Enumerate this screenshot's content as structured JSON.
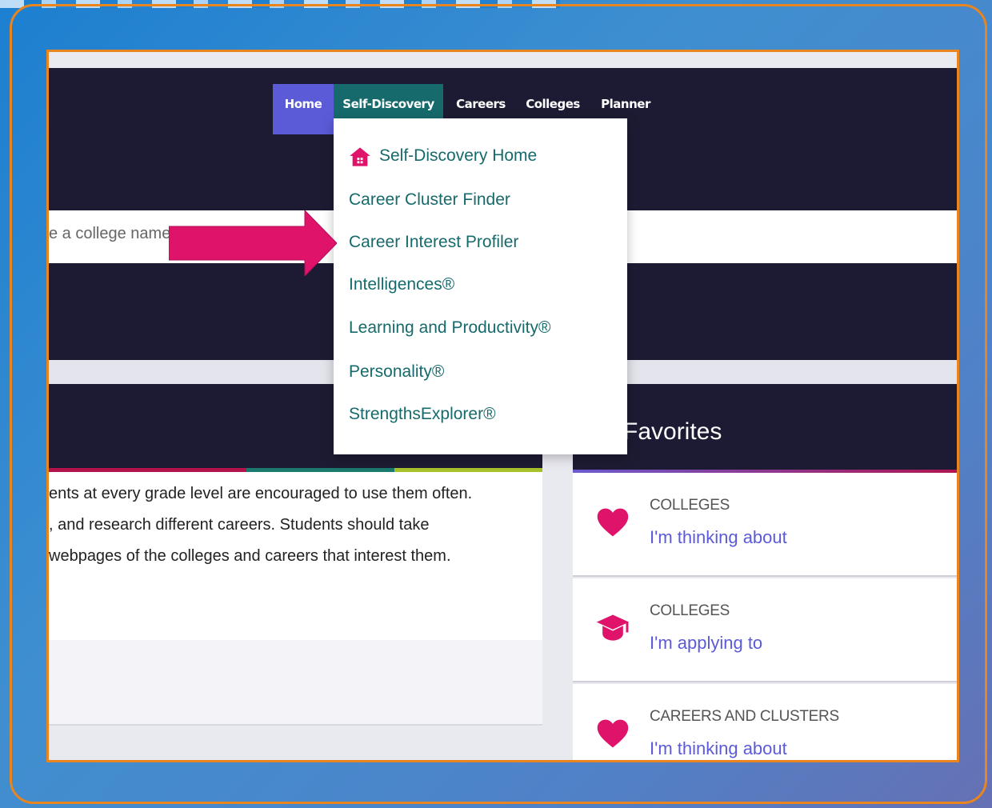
{
  "nav": {
    "items": [
      {
        "label": "Home"
      },
      {
        "label": "Self-Discovery"
      },
      {
        "label": "Careers"
      },
      {
        "label": "Colleges"
      },
      {
        "label": "Planner"
      }
    ]
  },
  "search": {
    "partial_text": "e a college name"
  },
  "dropdown": {
    "items": [
      {
        "label": "Self-Discovery Home",
        "icon": "home-icon"
      },
      {
        "label": "Career Cluster Finder"
      },
      {
        "label": "Career Interest Profiler"
      },
      {
        "label": "Intelligences®"
      },
      {
        "label": "Learning and Productivity®"
      },
      {
        "label": "Personality®"
      },
      {
        "label": "StrengthsExplorer®"
      }
    ]
  },
  "left_panel": {
    "lines": [
      "ents at every grade level are encouraged to use them often.",
      ", and research different careers. Students should take",
      " webpages of the colleges and careers that interest them."
    ]
  },
  "favorites": {
    "title": "Favorites",
    "cards": [
      {
        "category": "COLLEGES",
        "link": "I'm thinking about",
        "icon": "heart-icon"
      },
      {
        "category": "COLLEGES",
        "link": "I'm applying to",
        "icon": "graduation-cap-icon"
      },
      {
        "category": "CAREERS AND CLUSTERS",
        "link": "I'm thinking about",
        "icon": "heart-icon"
      }
    ]
  },
  "colors": {
    "accent_pink": "#e0136b",
    "nav_home_bg": "#5b5bd8",
    "nav_active_bg": "#166a6c",
    "frame_orange": "#e8851f"
  }
}
